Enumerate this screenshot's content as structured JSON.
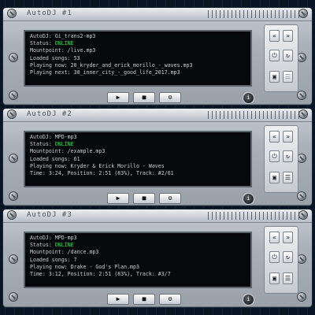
{
  "panels": [
    {
      "title": "AutoDJ #1",
      "lines": [
        {
          "label": "AutoDJ:",
          "value": "Gi_trans2-mp3"
        },
        {
          "label": "Status:",
          "value": "ONLINE"
        },
        {
          "label": "Mountpoint:",
          "value": "/live.mp3"
        },
        {
          "label": "Loaded songs:",
          "value": "53"
        },
        {
          "label": "Playing now:",
          "value": "20_kryder_and_erick_morillo_-_waves.mp3"
        },
        {
          "label": "Playing next:",
          "value": "30_inner_city_-_good_life_2017.mp3"
        }
      ]
    },
    {
      "title": "AutoDJ #2",
      "lines": [
        {
          "label": "AutoDJ:",
          "value": "MPD-mp3"
        },
        {
          "label": "Status:",
          "value": "ONLINE"
        },
        {
          "label": "Mountpoint:",
          "value": "/example.mp3"
        },
        {
          "label": "Loaded songs:",
          "value": "61"
        },
        {
          "label": "Playing now:",
          "value": "Kryder & Erick Morillo - Waves"
        },
        {
          "label": "Time:",
          "value": "3:24, Position: 2:51 (83%), Track: #2/61"
        }
      ]
    },
    {
      "title": "AutoDJ #3",
      "lines": [
        {
          "label": "AutoDJ:",
          "value": "MPD-mp3"
        },
        {
          "label": "Status:",
          "value": "ONLINE"
        },
        {
          "label": "Mountpoint:",
          "value": "/dance.mp3"
        },
        {
          "label": "Loaded songs:",
          "value": "7"
        },
        {
          "label": "Playing now:",
          "value": "Drake - God's Plan.mp3"
        },
        {
          "label": "Time:",
          "value": "3:12, Position: 2:51 (83%), Track: #3/7"
        }
      ]
    }
  ],
  "controls": {
    "play": "▶",
    "stop": "■",
    "settings": "⚙",
    "info": "i"
  },
  "side": {
    "prev": "«",
    "next": "»",
    "power": "⏻",
    "refresh": "↻",
    "save": "▣",
    "log": "☰"
  },
  "colors": {
    "status_online": "#2fe04a"
  }
}
